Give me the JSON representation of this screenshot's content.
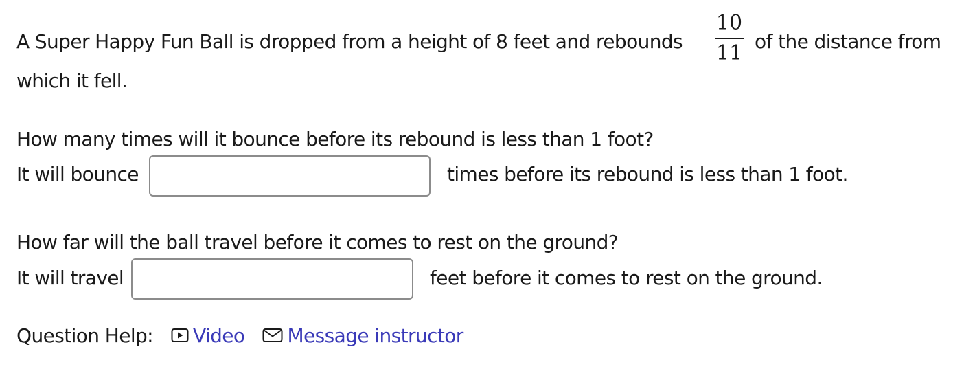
{
  "problem": {
    "intro_before_fraction": "A Super Happy Fun Ball is dropped from a height of 8 feet and rebounds",
    "fraction": {
      "numerator": "10",
      "denominator": "11"
    },
    "intro_after_fraction": "of the distance from",
    "intro_line2": "which it fell."
  },
  "part1": {
    "question": "How many times will it bounce before its rebound is less than 1 foot?",
    "prefix": "It will bounce",
    "input_value": "",
    "suffix": "times before its rebound is less than 1 foot."
  },
  "part2": {
    "question": "How far will the ball travel before it comes to rest on the ground?",
    "prefix": "It will travel",
    "input_value": "",
    "suffix": "feet before it comes to rest on the ground."
  },
  "help": {
    "label": "Question Help:",
    "links": [
      {
        "label": "Video",
        "icon": "video-play-icon"
      },
      {
        "label": "Message instructor",
        "icon": "envelope-icon"
      }
    ],
    "link_color": "#3a3ab8"
  }
}
